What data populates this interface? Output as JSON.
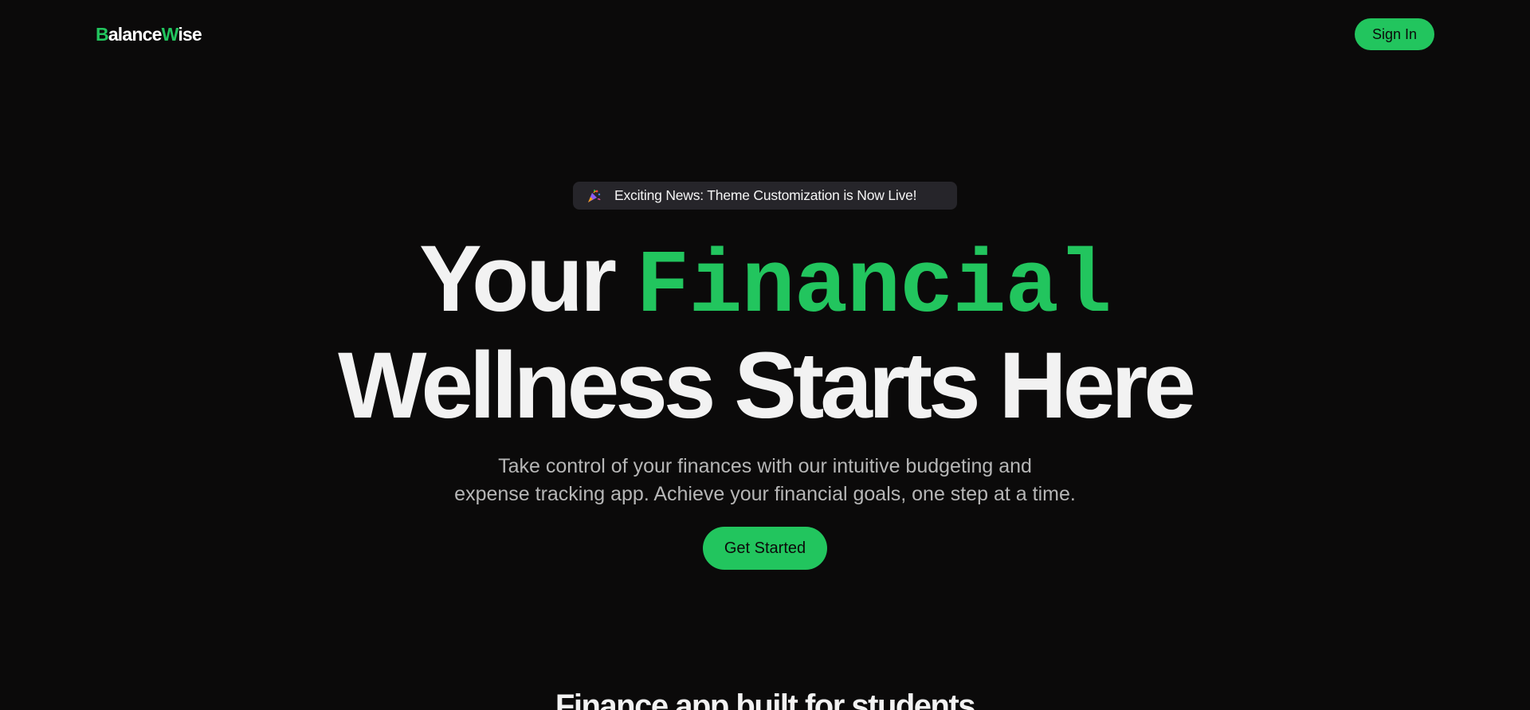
{
  "colors": {
    "background": "#0b0a0a",
    "accent": "#22c55e",
    "pill_background": "#26252a",
    "subtitle_text": "#b6b6b6"
  },
  "navbar": {
    "logo": {
      "first_initial": "B",
      "first_rest": "alance",
      "second_initial": "W",
      "second_rest": "ise"
    },
    "sign_in_label": "Sign In"
  },
  "announcement": {
    "icon": "party-popper-icon",
    "text": "Exciting News: Theme Customization is Now Live!"
  },
  "hero": {
    "title_word_1": "Your",
    "title_word_2_highlight": "Financial",
    "title_line_2": "Wellness Starts Here",
    "subtitle_line_1": "Take control of your finances with our intuitive budgeting and",
    "subtitle_line_2": "expense tracking app. Achieve your financial goals, one step at a time.",
    "cta_label": "Get Started"
  },
  "next_section": {
    "heading": "Finance app built for students"
  }
}
